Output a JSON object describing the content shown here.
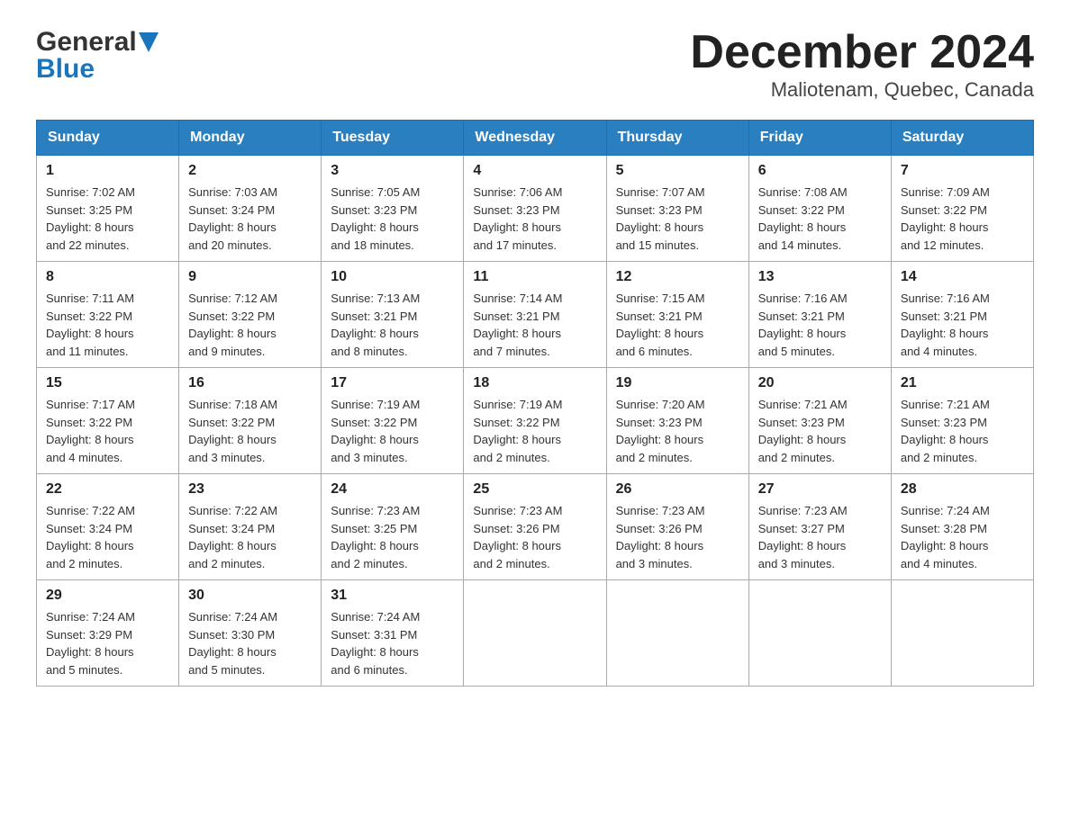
{
  "header": {
    "logo_text_general": "General",
    "logo_text_blue": "Blue",
    "title": "December 2024",
    "subtitle": "Maliotenam, Quebec, Canada"
  },
  "weekdays": [
    "Sunday",
    "Monday",
    "Tuesday",
    "Wednesday",
    "Thursday",
    "Friday",
    "Saturday"
  ],
  "weeks": [
    [
      {
        "day": "1",
        "sunrise": "7:02 AM",
        "sunset": "3:25 PM",
        "daylight": "8 hours and 22 minutes."
      },
      {
        "day": "2",
        "sunrise": "7:03 AM",
        "sunset": "3:24 PM",
        "daylight": "8 hours and 20 minutes."
      },
      {
        "day": "3",
        "sunrise": "7:05 AM",
        "sunset": "3:23 PM",
        "daylight": "8 hours and 18 minutes."
      },
      {
        "day": "4",
        "sunrise": "7:06 AM",
        "sunset": "3:23 PM",
        "daylight": "8 hours and 17 minutes."
      },
      {
        "day": "5",
        "sunrise": "7:07 AM",
        "sunset": "3:23 PM",
        "daylight": "8 hours and 15 minutes."
      },
      {
        "day": "6",
        "sunrise": "7:08 AM",
        "sunset": "3:22 PM",
        "daylight": "8 hours and 14 minutes."
      },
      {
        "day": "7",
        "sunrise": "7:09 AM",
        "sunset": "3:22 PM",
        "daylight": "8 hours and 12 minutes."
      }
    ],
    [
      {
        "day": "8",
        "sunrise": "7:11 AM",
        "sunset": "3:22 PM",
        "daylight": "8 hours and 11 minutes."
      },
      {
        "day": "9",
        "sunrise": "7:12 AM",
        "sunset": "3:22 PM",
        "daylight": "8 hours and 9 minutes."
      },
      {
        "day": "10",
        "sunrise": "7:13 AM",
        "sunset": "3:21 PM",
        "daylight": "8 hours and 8 minutes."
      },
      {
        "day": "11",
        "sunrise": "7:14 AM",
        "sunset": "3:21 PM",
        "daylight": "8 hours and 7 minutes."
      },
      {
        "day": "12",
        "sunrise": "7:15 AM",
        "sunset": "3:21 PM",
        "daylight": "8 hours and 6 minutes."
      },
      {
        "day": "13",
        "sunrise": "7:16 AM",
        "sunset": "3:21 PM",
        "daylight": "8 hours and 5 minutes."
      },
      {
        "day": "14",
        "sunrise": "7:16 AM",
        "sunset": "3:21 PM",
        "daylight": "8 hours and 4 minutes."
      }
    ],
    [
      {
        "day": "15",
        "sunrise": "7:17 AM",
        "sunset": "3:22 PM",
        "daylight": "8 hours and 4 minutes."
      },
      {
        "day": "16",
        "sunrise": "7:18 AM",
        "sunset": "3:22 PM",
        "daylight": "8 hours and 3 minutes."
      },
      {
        "day": "17",
        "sunrise": "7:19 AM",
        "sunset": "3:22 PM",
        "daylight": "8 hours and 3 minutes."
      },
      {
        "day": "18",
        "sunrise": "7:19 AM",
        "sunset": "3:22 PM",
        "daylight": "8 hours and 2 minutes."
      },
      {
        "day": "19",
        "sunrise": "7:20 AM",
        "sunset": "3:23 PM",
        "daylight": "8 hours and 2 minutes."
      },
      {
        "day": "20",
        "sunrise": "7:21 AM",
        "sunset": "3:23 PM",
        "daylight": "8 hours and 2 minutes."
      },
      {
        "day": "21",
        "sunrise": "7:21 AM",
        "sunset": "3:23 PM",
        "daylight": "8 hours and 2 minutes."
      }
    ],
    [
      {
        "day": "22",
        "sunrise": "7:22 AM",
        "sunset": "3:24 PM",
        "daylight": "8 hours and 2 minutes."
      },
      {
        "day": "23",
        "sunrise": "7:22 AM",
        "sunset": "3:24 PM",
        "daylight": "8 hours and 2 minutes."
      },
      {
        "day": "24",
        "sunrise": "7:23 AM",
        "sunset": "3:25 PM",
        "daylight": "8 hours and 2 minutes."
      },
      {
        "day": "25",
        "sunrise": "7:23 AM",
        "sunset": "3:26 PM",
        "daylight": "8 hours and 2 minutes."
      },
      {
        "day": "26",
        "sunrise": "7:23 AM",
        "sunset": "3:26 PM",
        "daylight": "8 hours and 3 minutes."
      },
      {
        "day": "27",
        "sunrise": "7:23 AM",
        "sunset": "3:27 PM",
        "daylight": "8 hours and 3 minutes."
      },
      {
        "day": "28",
        "sunrise": "7:24 AM",
        "sunset": "3:28 PM",
        "daylight": "8 hours and 4 minutes."
      }
    ],
    [
      {
        "day": "29",
        "sunrise": "7:24 AM",
        "sunset": "3:29 PM",
        "daylight": "8 hours and 5 minutes."
      },
      {
        "day": "30",
        "sunrise": "7:24 AM",
        "sunset": "3:30 PM",
        "daylight": "8 hours and 5 minutes."
      },
      {
        "day": "31",
        "sunrise": "7:24 AM",
        "sunset": "3:31 PM",
        "daylight": "8 hours and 6 minutes."
      },
      null,
      null,
      null,
      null
    ]
  ],
  "labels": {
    "sunrise": "Sunrise:",
    "sunset": "Sunset:",
    "daylight": "Daylight:"
  }
}
